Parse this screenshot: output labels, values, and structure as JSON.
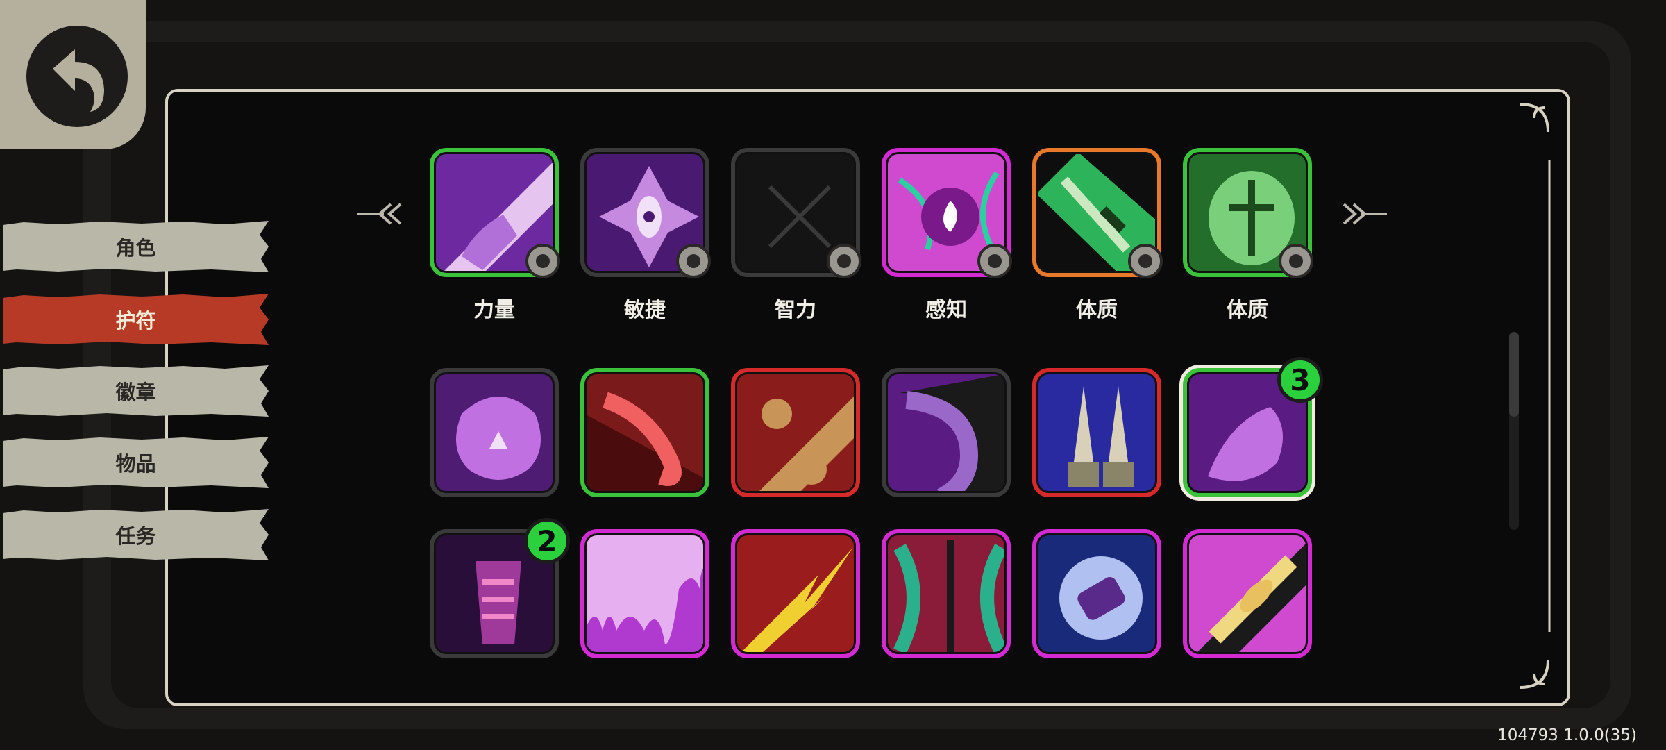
{
  "back_button": {
    "icon": "back-arrow-icon"
  },
  "side_tabs": [
    {
      "label": "角色",
      "selected": false
    },
    {
      "label": "护符",
      "selected": true
    },
    {
      "label": "徽章",
      "selected": false
    },
    {
      "label": "物品",
      "selected": false
    },
    {
      "label": "任务",
      "selected": false
    }
  ],
  "colors": {
    "tab_selected": "#b63a25",
    "tab_normal": "#b9b7a8",
    "badge_green": "#2ad13c",
    "rarity_green": "#3ac23a",
    "rarity_orange": "#e8782a",
    "rarity_red": "#d62a2a",
    "rarity_magenta": "#d42ad4",
    "rarity_grey": "#3b3a3a"
  },
  "equipped": [
    {
      "label": "力量",
      "icon": "purple-arm-icon",
      "rarity": "green",
      "stat_icon": "flame-icon"
    },
    {
      "label": "敏捷",
      "icon": "spiked-eye-icon",
      "rarity": "grey",
      "stat_icon": "speed-chevron-icon"
    },
    {
      "label": "智力",
      "icon": "empty-slot-x-icon",
      "rarity": "grey",
      "stat_icon": "swirl-icon"
    },
    {
      "label": "感知",
      "icon": "pink-flame-orb-icon",
      "rarity": "magenta",
      "stat_icon": "star-sparkle-icon"
    },
    {
      "label": "体质",
      "icon": "green-dagger-icon",
      "rarity": "orange",
      "stat_icon": "shield-icon"
    },
    {
      "label": "体质",
      "icon": "green-helmet-icon",
      "rarity": "green",
      "stat_icon": "shield-icon"
    }
  ],
  "inventory": [
    {
      "icon": "purple-skull-gem-icon",
      "rarity": "grey",
      "count": ""
    },
    {
      "icon": "red-tongue-icon",
      "rarity": "green",
      "count": ""
    },
    {
      "icon": "claw-fists-icon",
      "rarity": "red",
      "count": ""
    },
    {
      "icon": "purple-horn-icon",
      "rarity": "grey",
      "count": ""
    },
    {
      "icon": "twin-spikes-icon",
      "rarity": "red",
      "count": ""
    },
    {
      "icon": "ghost-hand-icon",
      "rarity": "green",
      "count": "3",
      "selected": true
    },
    {
      "icon": "fleshy-spine-icon",
      "rarity": "grey",
      "count": "2"
    },
    {
      "icon": "purple-slime-icon",
      "rarity": "magenta",
      "count": ""
    },
    {
      "icon": "lightning-arrow-icon",
      "rarity": "magenta",
      "count": ""
    },
    {
      "icon": "bone-spear-icon",
      "rarity": "magenta",
      "count": ""
    },
    {
      "icon": "crystal-burst-icon",
      "rarity": "magenta",
      "count": ""
    },
    {
      "icon": "golden-drill-icon",
      "rarity": "magenta",
      "count": ""
    }
  ],
  "nav": {
    "prev_icon": "chevron-left-double-icon",
    "next_icon": "chevron-right-double-icon"
  },
  "version": "104793 1.0.0(35)"
}
